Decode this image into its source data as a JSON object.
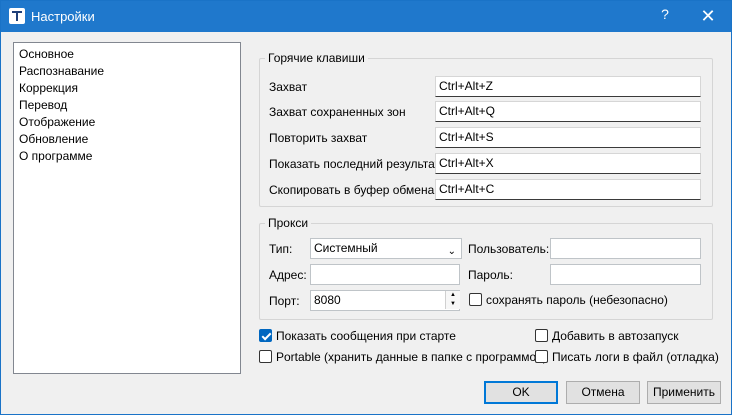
{
  "window": {
    "title": "Настройки",
    "help": "?",
    "close": "✕"
  },
  "sidebar": {
    "items": [
      "Основное",
      "Распознавание",
      "Коррекция",
      "Перевод",
      "Отображение",
      "Обновление",
      "О программе"
    ]
  },
  "hotkeys": {
    "title": "Горячие клавиши",
    "rows": [
      {
        "label": "Захват",
        "value": "Ctrl+Alt+Z"
      },
      {
        "label": "Захват сохраненных зон",
        "value": "Ctrl+Alt+Q"
      },
      {
        "label": "Повторить захват",
        "value": "Ctrl+Alt+S"
      },
      {
        "label": "Показать последний результат",
        "value": "Ctrl+Alt+X"
      },
      {
        "label": "Скопировать в буфер обмена",
        "value": "Ctrl+Alt+C"
      }
    ]
  },
  "proxy": {
    "title": "Прокси",
    "type_label": "Тип:",
    "type_value": "Системный",
    "user_label": "Пользователь:",
    "user_value": "",
    "address_label": "Адрес:",
    "address_value": "",
    "password_label": "Пароль:",
    "password_value": "",
    "port_label": "Порт:",
    "port_value": "8080",
    "save_password_label": "сохранять пароль (небезопасно)",
    "save_password_checked": false
  },
  "options": {
    "show_messages": {
      "label": "Показать сообщения при старте",
      "checked": true
    },
    "autostart": {
      "label": "Добавить в автозапуск",
      "checked": false
    },
    "portable": {
      "label": "Portable (хранить данные в папке с программой)",
      "checked": false
    },
    "write_logs": {
      "label": "Писать логи в файл (отладка)",
      "checked": false
    }
  },
  "buttons": {
    "ok": "OK",
    "cancel": "Отмена",
    "apply": "Применить"
  },
  "colors": {
    "titlebar": "#1f78cc",
    "accent": "#0078d7"
  }
}
